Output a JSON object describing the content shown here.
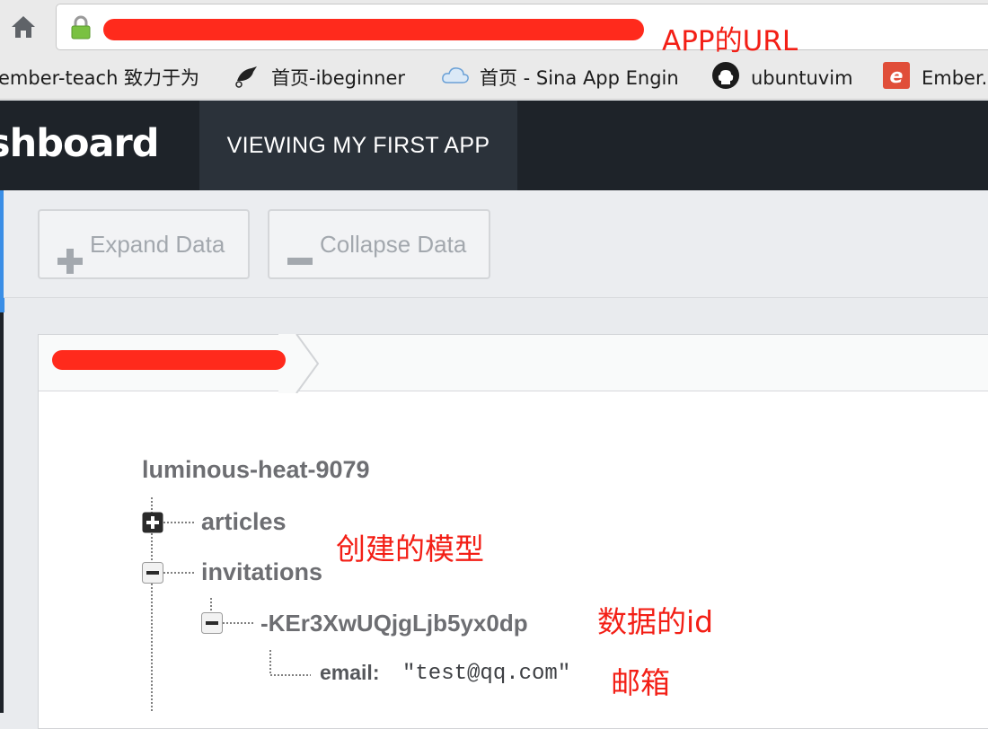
{
  "browser": {
    "annotation_url": "APP的URL",
    "bookmarks": [
      {
        "label": "ember-teach  致力于为",
        "icon": "none"
      },
      {
        "label": "首页-ibeginner",
        "icon": "bird-icon"
      },
      {
        "label": "首页 - Sina App Engin",
        "icon": "cloud-icon"
      },
      {
        "label": "ubuntuvim",
        "icon": "github-icon"
      },
      {
        "label": "Ember.",
        "icon": "ember-icon"
      }
    ]
  },
  "dashboard": {
    "title": "shboard",
    "tab_label": "VIEWING MY FIRST APP"
  },
  "actions": {
    "expand_label": "Expand Data",
    "collapse_label": "Collapse Data"
  },
  "tree": {
    "root": "luminous-heat-9079",
    "nodes": {
      "articles": "articles",
      "invitations": "invitations",
      "record_id": "-KEr3XwUQjgLjb5yx0dp",
      "email_key": "email:",
      "email_value": "\"test@qq.com\""
    }
  },
  "annotations": {
    "model": "创建的模型",
    "data_id": "数据的id",
    "mailbox": "邮箱"
  },
  "colors": {
    "annotation": "#f31f16",
    "header_bg": "#1e2329",
    "tab_bg": "#2b323a",
    "tree_text": "#6d6e72"
  }
}
